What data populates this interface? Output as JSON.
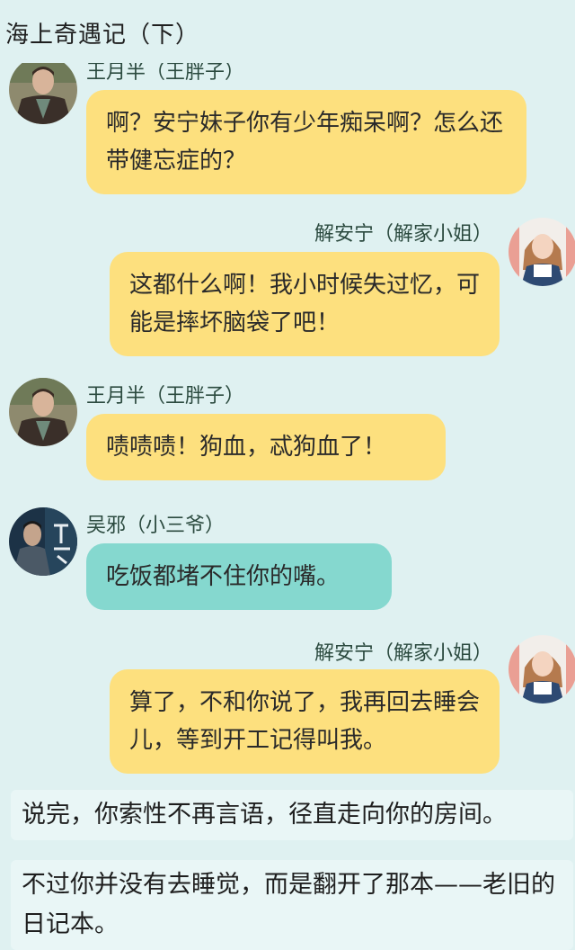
{
  "header": {
    "title": "海上奇遇记（下）"
  },
  "messages": [
    {
      "speaker": "王月半（王胖子）",
      "text": "啊？安宁妹子你有少年痴呆啊？怎么还带健忘症的？",
      "side": "left",
      "color": "#fde07e"
    },
    {
      "speaker": "解安宁（解家小姐）",
      "text": "这都什么啊！我小时候失过忆，可能是摔坏脑袋了吧！",
      "side": "right",
      "color": "#fde07e"
    },
    {
      "speaker": "王月半（王胖子）",
      "text": "啧啧啧！狗血，忒狗血了！",
      "side": "left",
      "color": "#fde07e"
    },
    {
      "speaker": "吴邪（小三爷）",
      "text": "吃饭都堵不住你的嘴。",
      "side": "left",
      "color": "#85d8cf"
    },
    {
      "speaker": "解安宁（解家小姐）",
      "text": "算了，不和你说了，我再回去睡会儿，等到开工记得叫我。",
      "side": "right",
      "color": "#fde07e"
    }
  ],
  "narration": [
    "说完，你索性不再言语，径直走向你的房间。",
    "不过你并没有去睡觉，而是翻开了那本——老旧的日记本。"
  ],
  "avatars": {
    "wang_pangzi": "man-leather-jacket-avatar",
    "xie_anning": "woman-overalls-avatar",
    "wu_xie": "wu-xie-poster-avatar"
  }
}
